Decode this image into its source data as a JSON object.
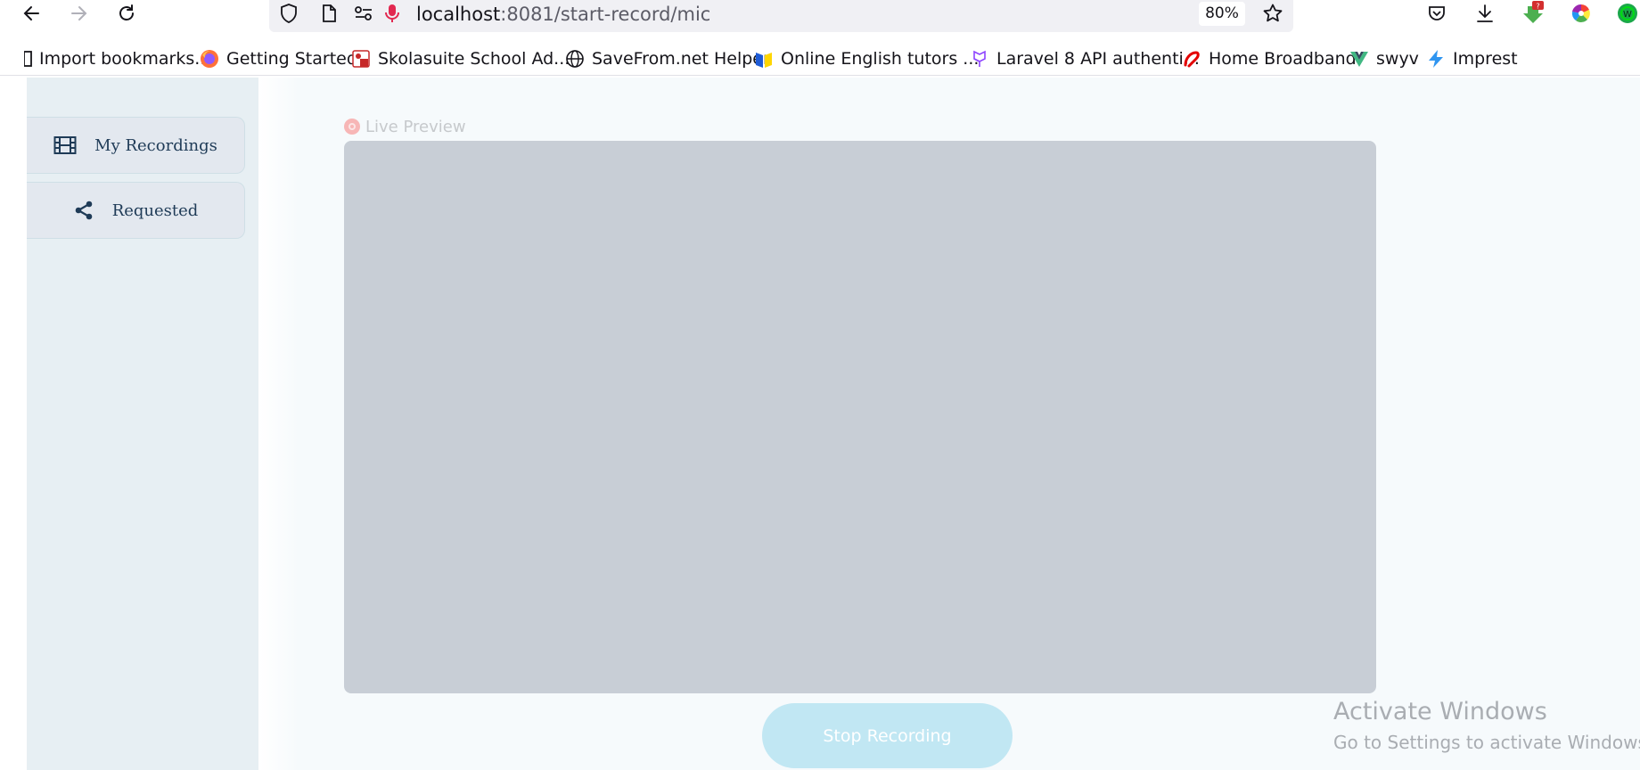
{
  "browser": {
    "url_host": "localhost",
    "url_rest": ":8081/start-record/mic",
    "zoom": "80%",
    "icons": [
      "back-icon",
      "forward-icon",
      "reload-icon",
      "shield-icon",
      "page-icon",
      "permissions-icon",
      "microphone-icon",
      "star-icon",
      "pocket-icon",
      "download-icon",
      "extension-download-icon",
      "color-wheel-icon",
      "green-extension-icon"
    ]
  },
  "bookmarks": [
    {
      "label": "Import bookmarks...",
      "icon": "import-icon"
    },
    {
      "label": "Getting Started",
      "icon": "firefox-icon"
    },
    {
      "label": "Skolasuite School Ad...",
      "icon": "skolasuite-icon"
    },
    {
      "label": "SaveFrom.net Helper",
      "icon": "globe-icon"
    },
    {
      "label": "Online English tutors ...",
      "icon": "tutor-icon"
    },
    {
      "label": "Laravel 8 API authenti...",
      "icon": "laravel-icon"
    },
    {
      "label": "Home Broadband",
      "icon": "airtel-icon"
    },
    {
      "label": "swyv",
      "icon": "vue-icon"
    },
    {
      "label": "Imprest",
      "icon": "bolt-icon"
    }
  ],
  "sidebar": {
    "items": [
      {
        "label": "My Recordings",
        "icon": "film-icon"
      },
      {
        "label": "Requested",
        "icon": "share-icon"
      }
    ]
  },
  "main": {
    "preview_label": "Live Preview",
    "stop_button": "Stop Recording"
  },
  "watermark": {
    "line1": "Activate Windows",
    "line2": "Go to Settings to activate Windows."
  },
  "colors": {
    "sidebar_bg": "#e7eff3",
    "sidebar_text": "#1f3b57",
    "preview_bg": "#c8ced6",
    "stop_button_bg": "#c1e7f3",
    "mic_red": "#e22850"
  }
}
